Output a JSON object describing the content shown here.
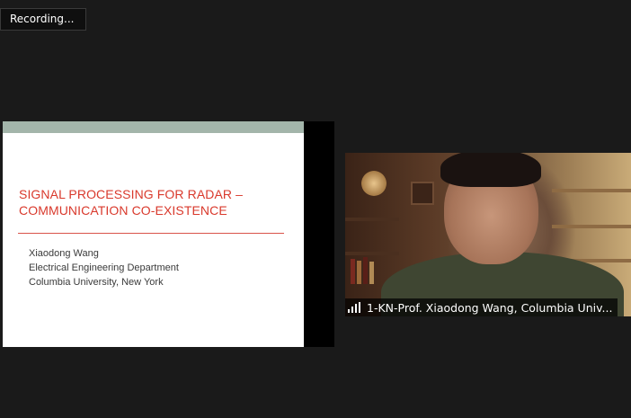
{
  "recording": {
    "label": "Recording..."
  },
  "slide": {
    "title_line1": "SIGNAL PROCESSING FOR RADAR –",
    "title_line2": "COMMUNICATION CO-EXISTENCE",
    "author": "Xiaodong Wang",
    "department": "Electrical Engineering Department",
    "affiliation": "Columbia University, New York",
    "title_color": "#d9392c",
    "band_color": "#a3b5aa"
  },
  "participant": {
    "name": "1-KN-Prof. Xiaodong Wang, Columbia Univ...",
    "signal_icon": "signal-bars-icon"
  }
}
